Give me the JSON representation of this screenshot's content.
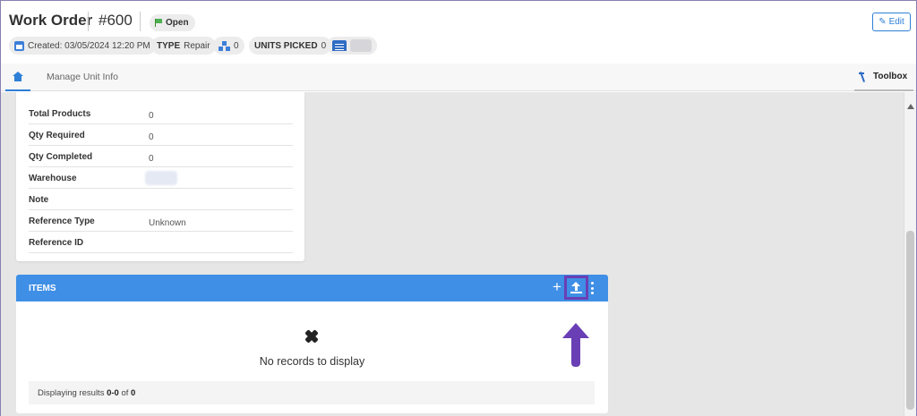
{
  "header": {
    "title": "Work Order",
    "order_number": "#600",
    "status": "Open",
    "edit_label": "Edit",
    "chips": {
      "created": "Created: 03/05/2024 12:20 PM",
      "type_label": "TYPE",
      "type_value": "Repair",
      "products_count": "0",
      "units_picked_label": "UNITS PICKED",
      "units_picked_value": "0"
    }
  },
  "tabs": {
    "manage": "Manage Unit Info",
    "toolbox": "Toolbox"
  },
  "details": [
    {
      "label": "Total Products",
      "value": "0"
    },
    {
      "label": "Qty Required",
      "value": "0"
    },
    {
      "label": "Qty Completed",
      "value": "0"
    },
    {
      "label": "Warehouse",
      "value": ""
    },
    {
      "label": "Note",
      "value": ""
    },
    {
      "label": "Reference Type",
      "value": "Unknown"
    },
    {
      "label": "Reference ID",
      "value": ""
    }
  ],
  "items": {
    "title": "ITEMS",
    "empty_message": "No records to display",
    "footer_prefix": "Displaying results ",
    "footer_range": "0-0",
    "footer_of": " of ",
    "footer_total": "0"
  },
  "colors": {
    "accent": "#2f7fd6",
    "items_header": "#3f8fe6",
    "annotation": "#6a3fb5"
  }
}
